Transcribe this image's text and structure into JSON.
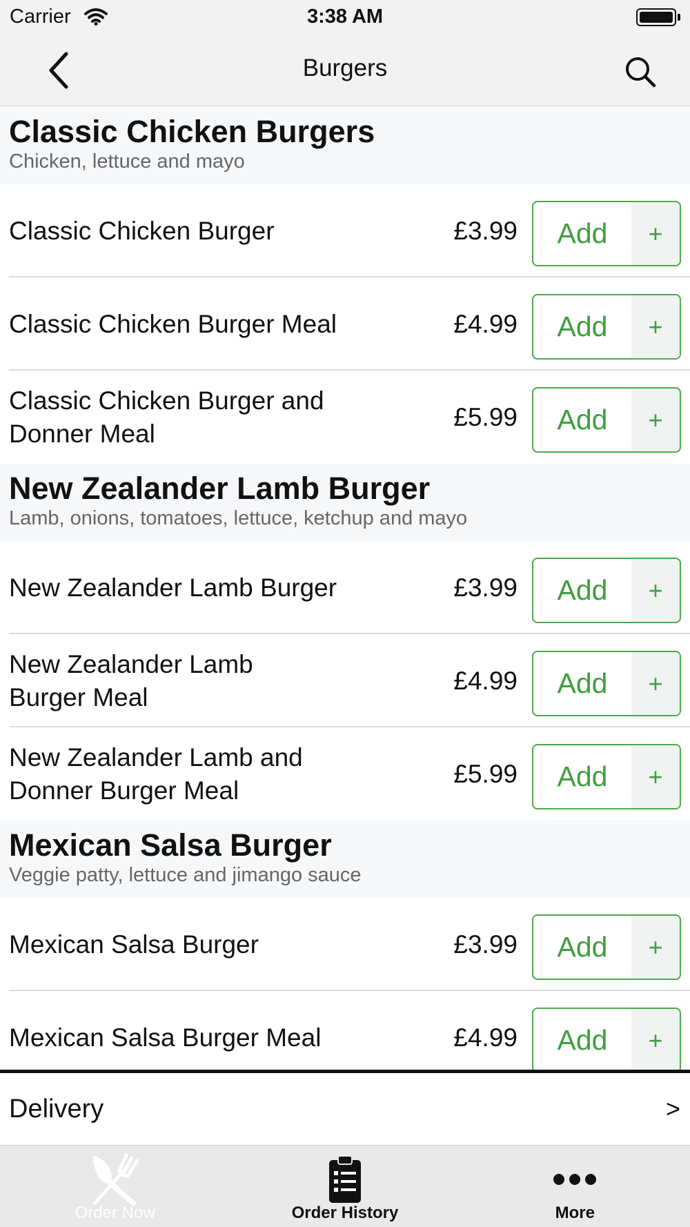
{
  "status_bar": {
    "carrier": "Carrier",
    "time": "3:38 AM"
  },
  "nav": {
    "title": "Burgers",
    "back_icon": "chevron-left-icon",
    "search_icon": "search-icon"
  },
  "menu": {
    "add_label": "Add",
    "plus_label": "+",
    "sections": [
      {
        "title": "Classic Chicken Burgers",
        "description": "Chicken, lettuce and mayo",
        "items": [
          {
            "name": "Classic Chicken Burger",
            "price": "£3.99"
          },
          {
            "name": "Classic Chicken Burger Meal",
            "price": "£4.99"
          },
          {
            "name": "Classic Chicken Burger and Donner Meal",
            "price": "£5.99"
          }
        ]
      },
      {
        "title": "New Zealander Lamb Burger",
        "description": "Lamb, onions, tomatoes, lettuce, ketchup and mayo",
        "items": [
          {
            "name": "New Zealander Lamb Burger",
            "price": "£3.99"
          },
          {
            "name": "New Zealander Lamb Burger Meal",
            "price": "£4.99"
          },
          {
            "name": "New Zealander Lamb and Donner Burger Meal",
            "price": "£5.99"
          }
        ]
      },
      {
        "title": "Mexican Salsa Burger",
        "description": "Veggie patty, lettuce and jimango sauce",
        "items": [
          {
            "name": "Mexican Salsa Burger",
            "price": "£3.99"
          },
          {
            "name": "Mexican Salsa Burger Meal",
            "price": "£4.99"
          }
        ]
      }
    ]
  },
  "delivery": {
    "label": "Delivery",
    "arrow": ">"
  },
  "tabs": [
    {
      "label": "Order Now",
      "icon": "fork-knife-icon",
      "active": true
    },
    {
      "label": "Order History",
      "icon": "clipboard-list-icon",
      "active": false
    },
    {
      "label": "More",
      "icon": "more-dots-icon",
      "active": false
    }
  ],
  "colors": {
    "accent_green": "#3e9f3d",
    "bar_gray": "#f2f2f2",
    "tab_bar": "#e9e9e9",
    "section_bg": "#f6f7f9"
  }
}
